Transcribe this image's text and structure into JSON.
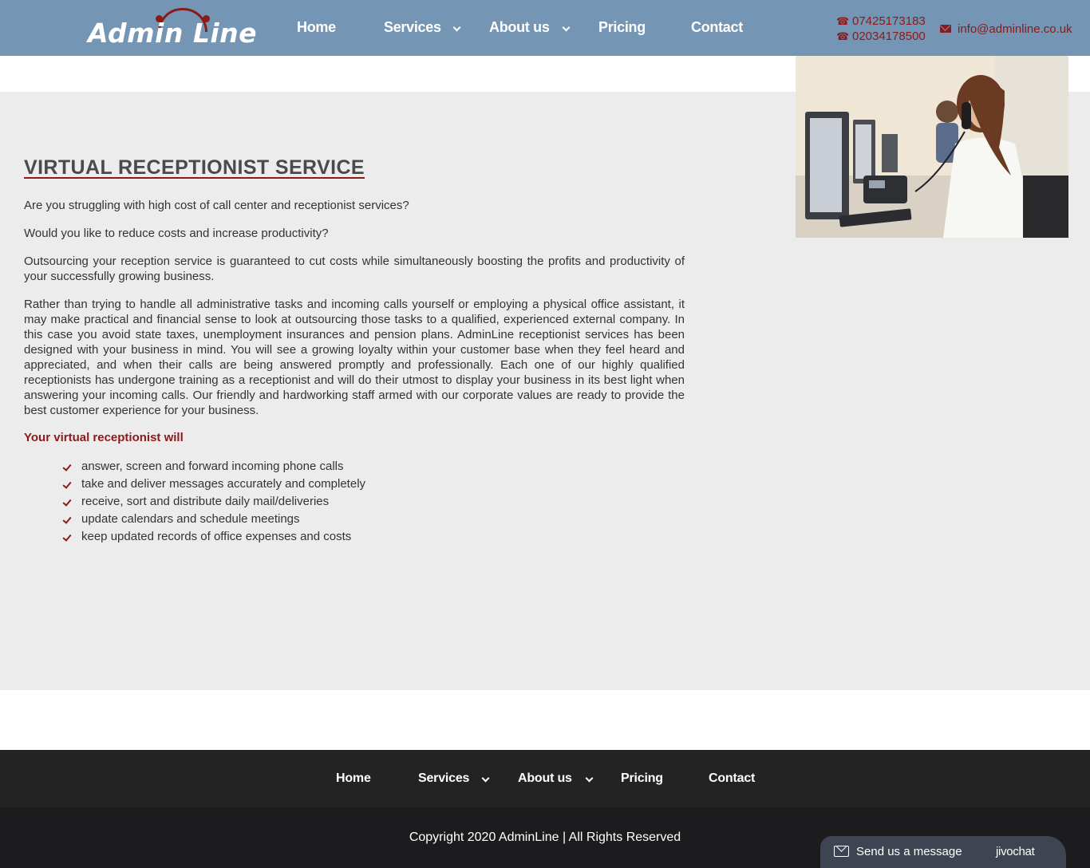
{
  "colors": {
    "header_bg": "#7496b4",
    "accent": "#8b1a1a",
    "content_bg": "#ececec",
    "footer_bg": "#232323"
  },
  "brand": {
    "logo_text": "Admin Line"
  },
  "header": {
    "nav": [
      {
        "label": "Home"
      },
      {
        "label": "Services",
        "has_dropdown": true
      },
      {
        "label": "About us",
        "has_dropdown": true
      },
      {
        "label": "Pricing"
      },
      {
        "label": "Contact"
      }
    ],
    "phones": [
      "07425173183",
      "02034178500"
    ],
    "email": "info@adminline.co.uk",
    "icons": {
      "phone": "phone-icon",
      "email": "envelope-icon",
      "dropdown": "chevron-down-icon"
    }
  },
  "main": {
    "title": "VIRTUAL RECEPTIONIST SERVICE",
    "paragraphs": [
      "Are you struggling with high cost of call center and receptionist services?",
      "Would you like to reduce costs and increase productivity?",
      "Outsourcing your reception service is guaranteed to cut costs while simultaneously boosting the profits and productivity of your successfully growing business.",
      "Rather than trying to handle all administrative tasks and incoming calls yourself or employing a physical office assistant, it may make practical and financial sense to look at outsourcing those tasks to a qualified, experienced external company. In this case you avoid state taxes, unemployment insurances and pension plans. AdminLine receptionist services has been designed with your business in mind. You will see a growing loyalty within your customer base when they feel heard and appreciated, and when their calls are being answered promptly and professionally. Each one of our highly qualified receptionists has undergone training as a receptionist and will do their utmost to display your business in its best light when answering your incoming calls. Our friendly and hardworking staff armed with our corporate values are ready to provide the best customer experience for your business."
    ],
    "list_heading": "Your virtual receptionist will",
    "list_items": [
      "answer, screen and forward incoming phone calls",
      "take and deliver messages accurately and completely",
      "receive, sort and distribute daily mail/deliveries",
      "update calendars and schedule meetings",
      "keep updated records of office expenses and costs"
    ],
    "photo_icon": "receptionist-photo"
  },
  "footer": {
    "nav": [
      {
        "label": "Home"
      },
      {
        "label": "Services",
        "has_dropdown": true
      },
      {
        "label": "About us",
        "has_dropdown": true
      },
      {
        "label": "Pricing"
      },
      {
        "label": "Contact"
      }
    ],
    "copyright": "Copyright 2020 AdminLine | All Rights Reserved"
  },
  "chat_widget": {
    "label": "Send us a message",
    "brand": "jivochat",
    "icon": "envelope-icon"
  }
}
